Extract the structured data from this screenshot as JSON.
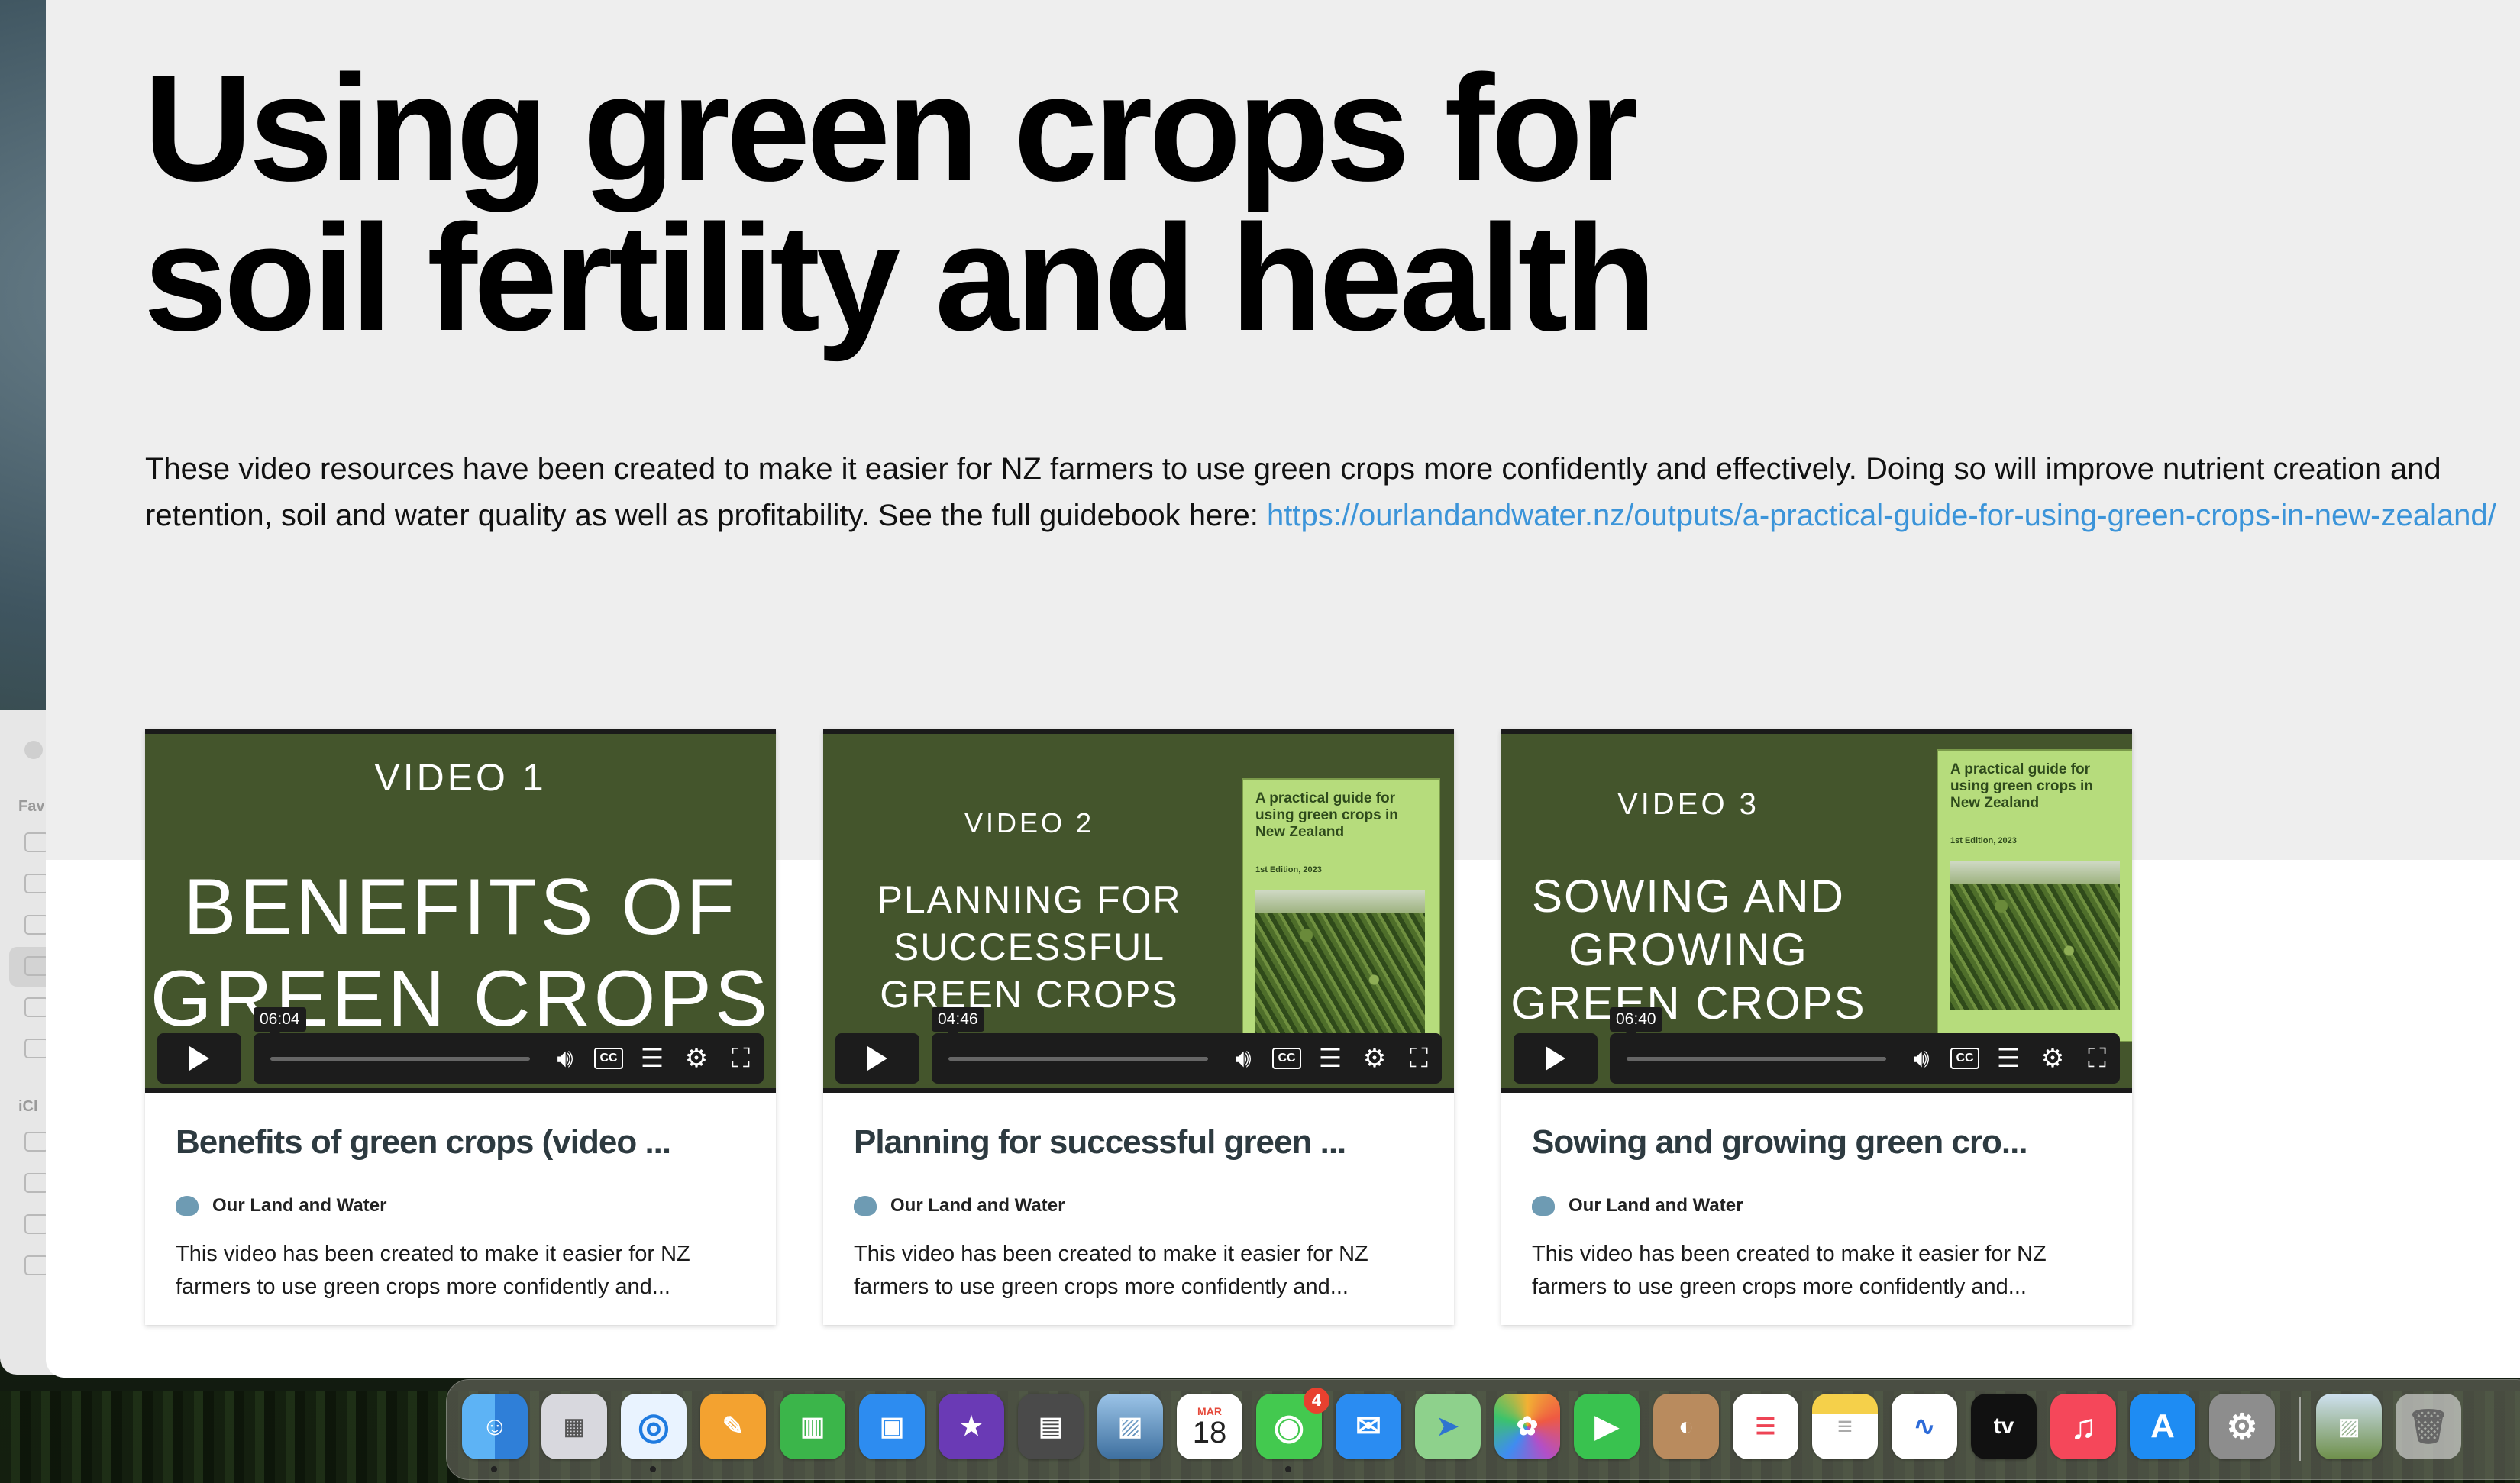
{
  "page": {
    "title": "Using green crops for soil fertility and health",
    "title_line1": "Using green crops for",
    "title_line2": "soil fertility and health",
    "description": "These video resources have been created to make it easier for NZ farmers to use green crops more confidently and effectively. Doing so will improve nutrient creation and retention, soil and water quality as well as profitability. See the full guidebook here: ",
    "guide_link": "https://ourlandandwater.nz/outputs/a-practical-guide-for-using-green-crops-in-new-zealand/"
  },
  "videos": [
    {
      "thumb_number": "VIDEO 1",
      "thumb_line1": "BENEFITS OF",
      "thumb_line2": "GREEN CROPS",
      "thumb_line3": "",
      "duration": "06:04",
      "title": "Benefits of green crops (video ...",
      "author": "Our Land and Water",
      "description": "This video has been created to make it easier for NZ farmers to use green crops more confidently and..."
    },
    {
      "thumb_number": "VIDEO 2",
      "thumb_line1": "PLANNING FOR",
      "thumb_line2": "SUCCESSFUL",
      "thumb_line3": "GREEN CROPS",
      "duration": "04:46",
      "title": "Planning for successful green ...",
      "author": "Our Land and Water",
      "description": "This video has been created to make it easier for NZ farmers to use green crops more confidently and...",
      "guide_title": "A practical guide for using green crops in New Zealand",
      "guide_edition": "1st Edition, 2023"
    },
    {
      "thumb_number": "VIDEO 3",
      "thumb_line1": "SOWING AND",
      "thumb_line2": "GROWING",
      "thumb_line3": "GREEN CROPS",
      "duration": "06:40",
      "title": "Sowing and growing green cro...",
      "author": "Our Land and Water",
      "description": "This video has been created to make it easier for NZ farmers to use green crops more confidently and...",
      "guide_title": "A practical guide for using green crops in New Zealand",
      "guide_edition": "1st Edition, 2023"
    }
  ],
  "sidebar_behind": {
    "label_favorites": "Fav",
    "label_icloud": "iCl"
  },
  "dock": {
    "calendar_month": "MAR",
    "calendar_day": "18",
    "messages_badge": "4",
    "tv_label": "tv"
  },
  "colors": {
    "thumb_green": "#44552c",
    "link_blue": "#3b94d9",
    "hero_gray": "#eeeeee"
  }
}
